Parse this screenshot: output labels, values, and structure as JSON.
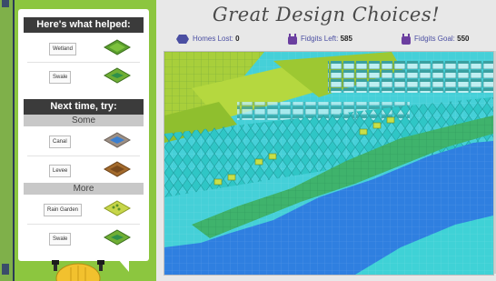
{
  "panel": {
    "helped_header": "Here's what helped:",
    "next_header": "Next time, try:",
    "some_label": "Some",
    "more_label": "More",
    "helped_items": [
      {
        "label": "Wetland",
        "icon": "wetland-icon"
      },
      {
        "label": "Swale",
        "icon": "swale-icon"
      }
    ],
    "some_items": [
      {
        "label": "Canal",
        "icon": "canal-icon"
      },
      {
        "label": "Levee",
        "icon": "levee-icon"
      }
    ],
    "more_items": [
      {
        "label": "Rain Garden",
        "icon": "rain-garden-icon"
      },
      {
        "label": "Swale",
        "icon": "swale-icon"
      }
    ]
  },
  "game": {
    "title": "Great Design Choices!",
    "homes_lost_label": "Homes Lost:",
    "homes_lost_value": "0",
    "fidgits_left_label": "Fidgits Left:",
    "fidgits_left_value": "585",
    "fidgits_goal_label": "Fidgits Goal:",
    "fidgits_goal_value": "550"
  },
  "colors": {
    "accent_green": "#8cc63f",
    "water_blue": "#2f7fe0",
    "stat_label": "#4b4fa2",
    "header_dark": "#3b3b3b"
  }
}
